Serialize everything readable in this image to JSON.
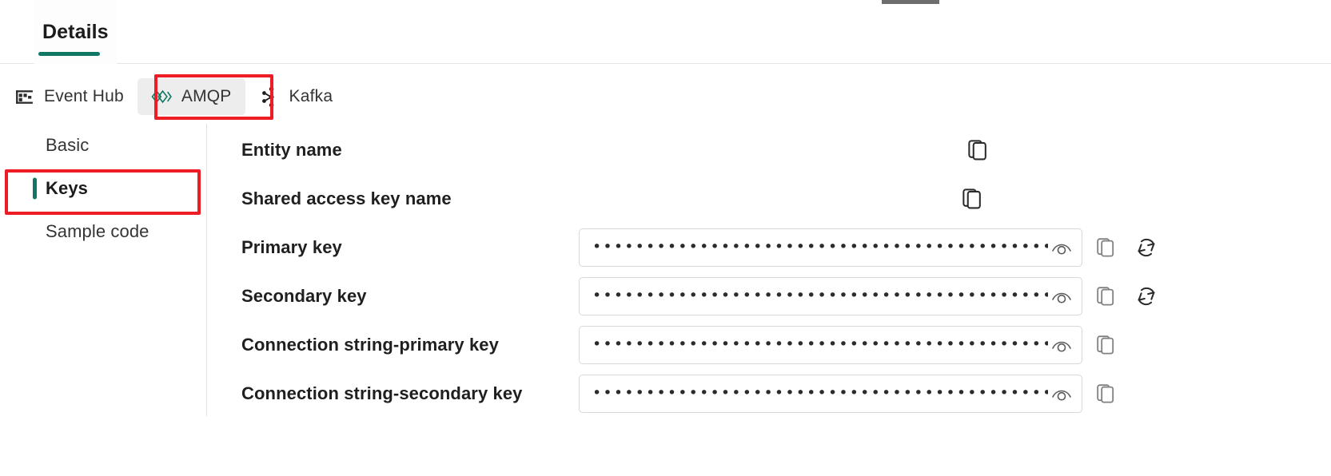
{
  "window": {
    "details_tab_label": "Details",
    "accent_color": "#117865",
    "highlight_color": "#ee1c25"
  },
  "protocol_tabs": [
    {
      "label": "Event Hub",
      "icon": "event-hub-icon",
      "selected": false
    },
    {
      "label": "AMQP",
      "icon": "amqp-icon",
      "selected": true
    },
    {
      "label": "Kafka",
      "icon": "kafka-icon",
      "selected": false
    }
  ],
  "sidebar": {
    "items": [
      {
        "label": "Basic",
        "active": false
      },
      {
        "label": "Keys",
        "active": true
      },
      {
        "label": "Sample code",
        "active": false
      }
    ]
  },
  "form": {
    "rows": [
      {
        "label": "Entity name",
        "type": "plain",
        "value": "",
        "copy_icon": "copy-icon"
      },
      {
        "label": "Shared access key name",
        "type": "plain",
        "value": "",
        "copy_icon": "copy-icon"
      },
      {
        "label": "Primary key",
        "type": "masked",
        "value": "••••••••••••••••••••••••••••••••••••••••••••••••••••••••••",
        "reveal_icon": "eye-icon",
        "copy_icon": "copy-icon",
        "regenerate_icon": "regenerate-icon"
      },
      {
        "label": "Secondary key",
        "type": "masked",
        "value": "••••••••••••••••••••••••••••••••••••••••••••••••••••••••••",
        "reveal_icon": "eye-icon",
        "copy_icon": "copy-icon",
        "regenerate_icon": "regenerate-icon"
      },
      {
        "label": "Connection string-primary key",
        "type": "masked",
        "value": "••••••••••••••••••••••••••••••••••••••••••••••••••••••••••",
        "reveal_icon": "eye-icon",
        "copy_icon": "copy-icon",
        "regenerate_icon": null
      },
      {
        "label": "Connection string-secondary key",
        "type": "masked",
        "value": "••••••••••••••••••••••••••••••••••••••••••••••••••••••••••",
        "reveal_icon": "eye-icon",
        "copy_icon": "copy-icon",
        "regenerate_icon": null
      }
    ]
  }
}
